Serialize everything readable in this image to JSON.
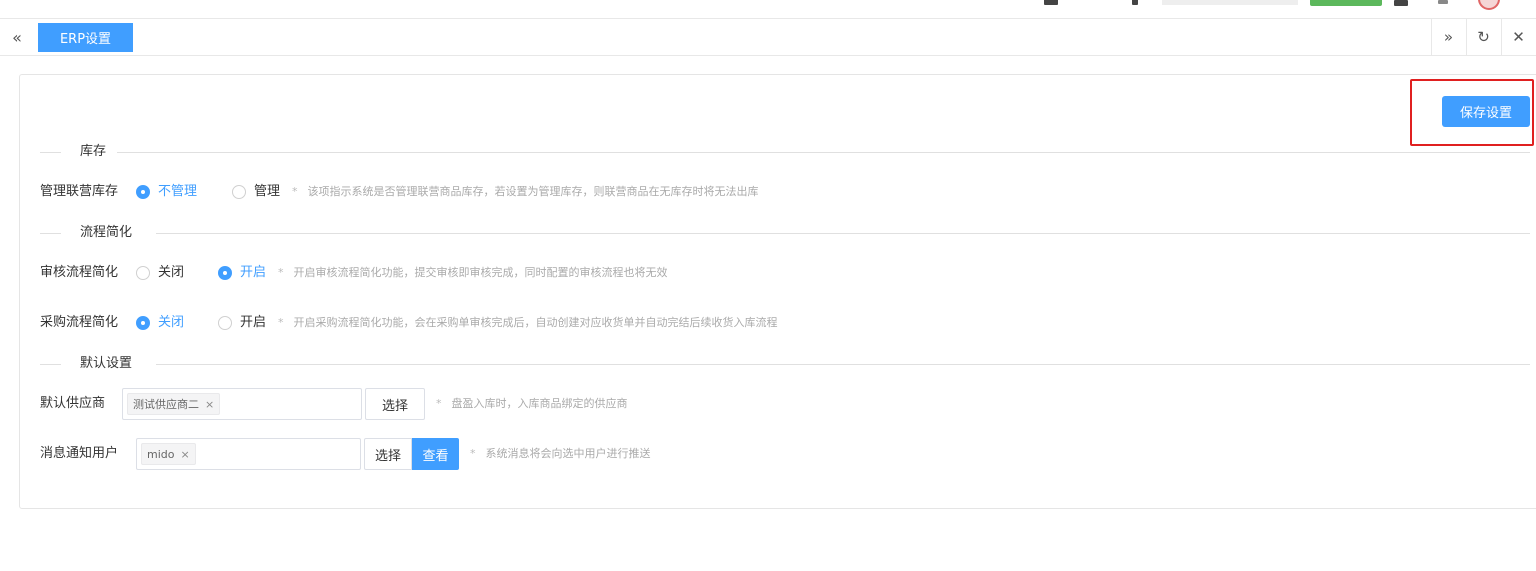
{
  "tabs": {
    "prev_icon": "«",
    "active_label": "ERP设置",
    "next_icon": "»",
    "refresh_icon": "↻",
    "close_icon": "✕"
  },
  "toolbar": {
    "save_label": "保存设置"
  },
  "sections": {
    "inventory": "库存",
    "process": "流程简化",
    "defaults": "默认设置"
  },
  "inventory": {
    "label": "管理联营库存",
    "options": [
      "不管理",
      "管理"
    ],
    "selected": "不管理",
    "hint": "该项指示系统是否管理联营商品库存，若设置为管理库存，则联营商品在无库存时将无法出库"
  },
  "audit": {
    "label": "审核流程简化",
    "options": [
      "关闭",
      "开启"
    ],
    "selected": "开启",
    "hint": "开启审核流程简化功能，提交审核即审核完成，同时配置的审核流程也将无效"
  },
  "purchase": {
    "label": "采购流程简化",
    "options": [
      "关闭",
      "开启"
    ],
    "selected": "关闭",
    "hint": "开启采购流程简化功能，会在采购单审核完成后，自动创建对应收货单并自动完结后续收货入库流程"
  },
  "supplier": {
    "label": "默认供应商",
    "tag": "测试供应商二",
    "select_label": "选择",
    "hint": "盘盈入库时，入库商品绑定的供应商"
  },
  "notify": {
    "label": "消息通知用户",
    "tag": "mido",
    "select_label": "选择",
    "view_label": "查看",
    "hint": "系统消息将会向选中用户进行推送"
  },
  "hint_star": "*",
  "tag_close": "×",
  "colors": {
    "primary": "#409eff",
    "highlight": "#e02020",
    "header_green": "#5cb85c"
  }
}
